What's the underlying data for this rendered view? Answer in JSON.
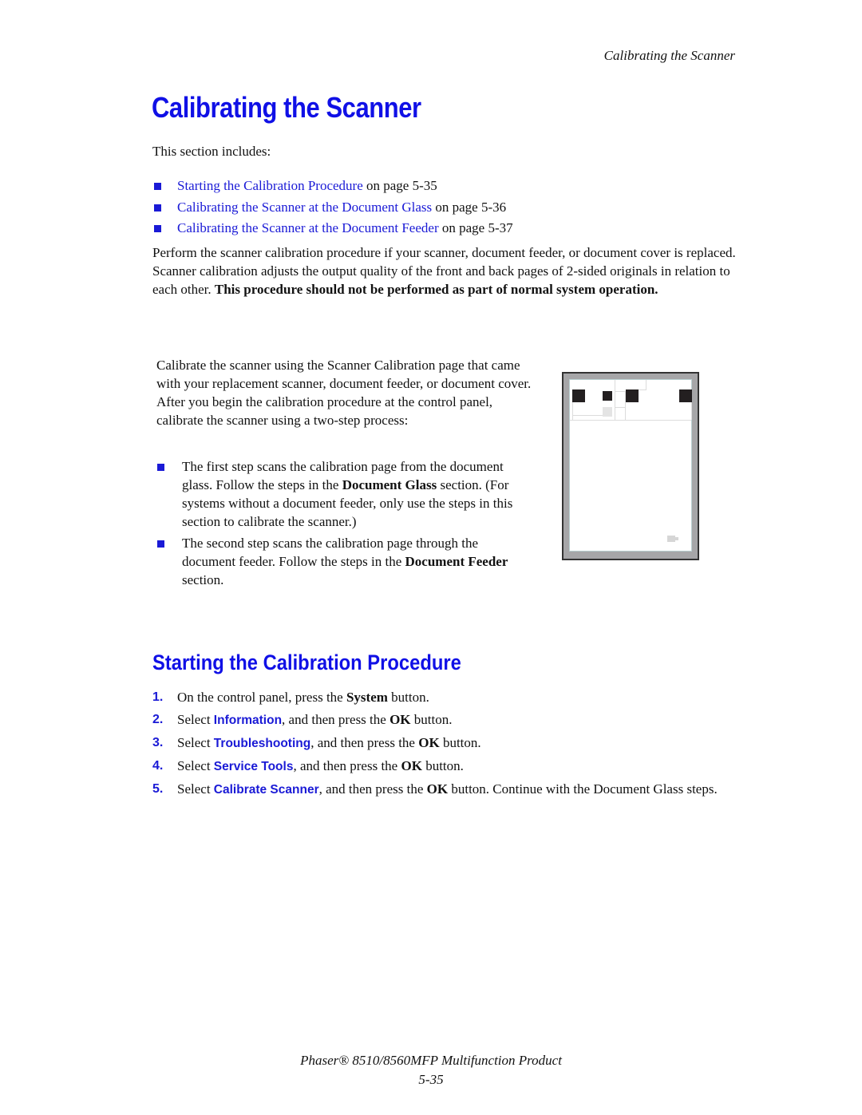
{
  "running_header": "Calibrating the Scanner",
  "title": "Calibrating the Scanner",
  "intro": "This section includes:",
  "toc": [
    {
      "link": "Starting the Calibration Procedure",
      "suffix": " on page 5-35"
    },
    {
      "link": "Calibrating the Scanner at the Document Glass",
      "suffix": " on page 5-36"
    },
    {
      "link": "Calibrating the Scanner at the Document Feeder",
      "suffix": " on page 5-37"
    }
  ],
  "perform": {
    "text": "Perform the scanner calibration procedure if your scanner, document feeder, or document cover is replaced. Scanner calibration adjusts the output quality of the front and back pages of 2-sided originals in relation to each other. ",
    "bold": "This procedure should not be performed as part of normal system operation."
  },
  "calibrate_para": "Calibrate the scanner using the Scanner Calibration page that came with your replacement scanner, document feeder, or document cover. After you begin the calibration procedure at the control panel, calibrate the scanner using a two-step process:",
  "two_steps": [
    {
      "pre": "The first step scans the calibration page from the document glass. Follow the steps in the ",
      "bold": "Document Glass",
      "post": " section. (For systems without a document feeder, only use the steps in this section to calibrate the scanner.)"
    },
    {
      "pre": "The second step scans the calibration page through the document feeder. Follow the steps in the ",
      "bold": "Document Feeder",
      "post": " section."
    }
  ],
  "figure": {
    "name": "Scanner Calibration page illustration"
  },
  "subheading": "Starting the Calibration Procedure",
  "procedure": [
    {
      "num": "1.",
      "pre": "On the control panel, press the ",
      "ui": "",
      "bold": "System",
      "post": " button."
    },
    {
      "num": "2.",
      "pre": "Select ",
      "ui": "Information",
      "mid": ", and then press the ",
      "bold": "OK",
      "post": " button."
    },
    {
      "num": "3.",
      "pre": "Select ",
      "ui": "Troubleshooting",
      "mid": ", and then press the ",
      "bold": "OK",
      "post": " button."
    },
    {
      "num": "4.",
      "pre": "Select ",
      "ui": "Service Tools",
      "mid": ", and then press the ",
      "bold": "OK",
      "post": " button."
    },
    {
      "num": "5.",
      "pre": "Select ",
      "ui": "Calibrate Scanner",
      "mid": ", and then press the ",
      "bold": "OK",
      "post": " button. Continue with the Document Glass steps."
    }
  ],
  "footer": {
    "product": "Phaser® 8510/8560MFP Multifunction Product",
    "page": "5-35"
  },
  "colors": {
    "heading": "#1010e6",
    "link": "#1a1ad6",
    "text": "#111111"
  }
}
